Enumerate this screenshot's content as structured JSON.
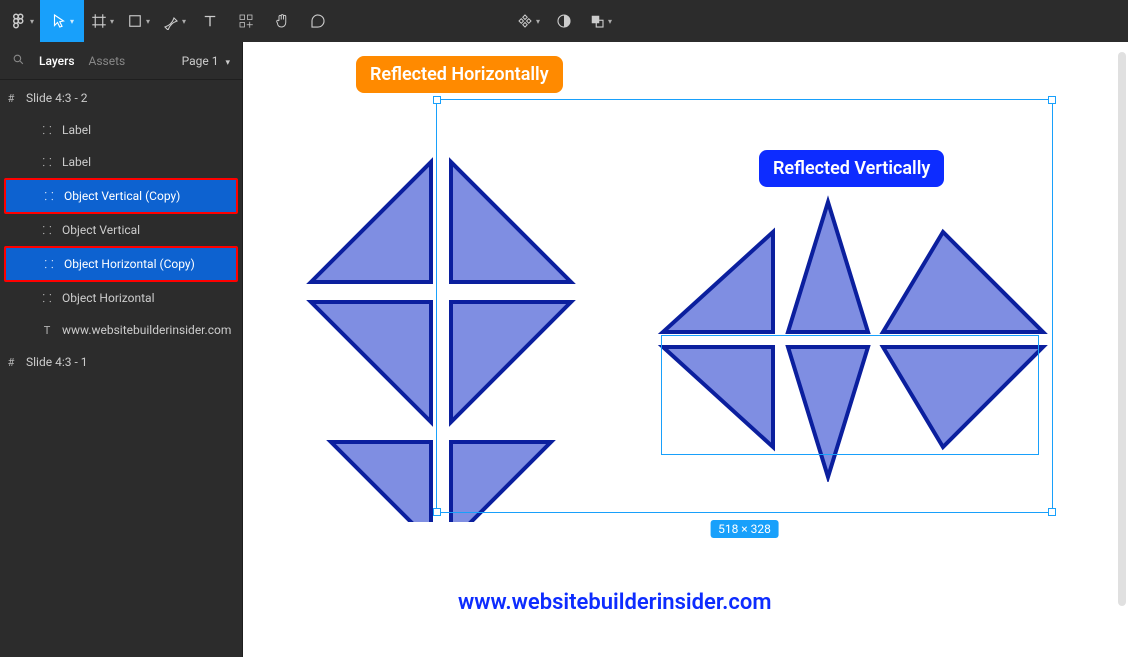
{
  "toolbar": {
    "tools": [
      {
        "name": "figma-menu",
        "glyph": "figma",
        "chev": true
      },
      {
        "name": "move-tool",
        "glyph": "cursor",
        "active": true,
        "chev": true
      },
      {
        "name": "frame-tool",
        "glyph": "frame",
        "chev": true
      },
      {
        "name": "shape-tool",
        "glyph": "rect",
        "chev": true
      },
      {
        "name": "pen-tool",
        "glyph": "pen",
        "chev": true
      },
      {
        "name": "text-tool",
        "glyph": "text"
      },
      {
        "name": "resources-tool",
        "glyph": "resources"
      },
      {
        "name": "hand-tool",
        "glyph": "hand"
      },
      {
        "name": "comment-tool",
        "glyph": "comment"
      }
    ],
    "center_tools": [
      {
        "name": "components-tool",
        "glyph": "component",
        "chev": true
      },
      {
        "name": "mask-tool",
        "glyph": "mask"
      },
      {
        "name": "boolean-tool",
        "glyph": "boolean",
        "chev": true
      }
    ]
  },
  "panel": {
    "tabs": {
      "layers": "Layers",
      "assets": "Assets"
    },
    "page_label": "Page 1",
    "layers": [
      {
        "name": "frame-slide-2",
        "icon": "#",
        "label": "Slide 4:3 - 2",
        "indent": 0
      },
      {
        "name": "layer-label-1",
        "icon": "::",
        "label": "Label",
        "indent": 2
      },
      {
        "name": "layer-label-2",
        "icon": "::",
        "label": "Label",
        "indent": 2
      },
      {
        "name": "layer-obj-vert-copy",
        "icon": "::",
        "label": "Object Vertical (Copy)",
        "indent": 2,
        "selected": true,
        "highlight": true
      },
      {
        "name": "layer-obj-vert",
        "icon": "::",
        "label": "Object Vertical",
        "indent": 2
      },
      {
        "name": "layer-obj-horiz-copy",
        "icon": "::",
        "label": "Object Horizontal (Copy)",
        "indent": 2,
        "selected": true,
        "highlight": true
      },
      {
        "name": "layer-obj-horiz",
        "icon": "::",
        "label": "Object Horizontal",
        "indent": 2
      },
      {
        "name": "layer-url",
        "icon": "T",
        "label": "www.websitebuilderinsider.com",
        "indent": 2
      },
      {
        "name": "frame-slide-1",
        "icon": "#",
        "label": "Slide 4:3 - 1",
        "indent": 0
      }
    ]
  },
  "canvas": {
    "label_h": "Reflected Horizontally",
    "label_v": "Reflected Vertically",
    "url": "www.websitebuilderinsider.com",
    "selection_size": "518 × 328"
  }
}
